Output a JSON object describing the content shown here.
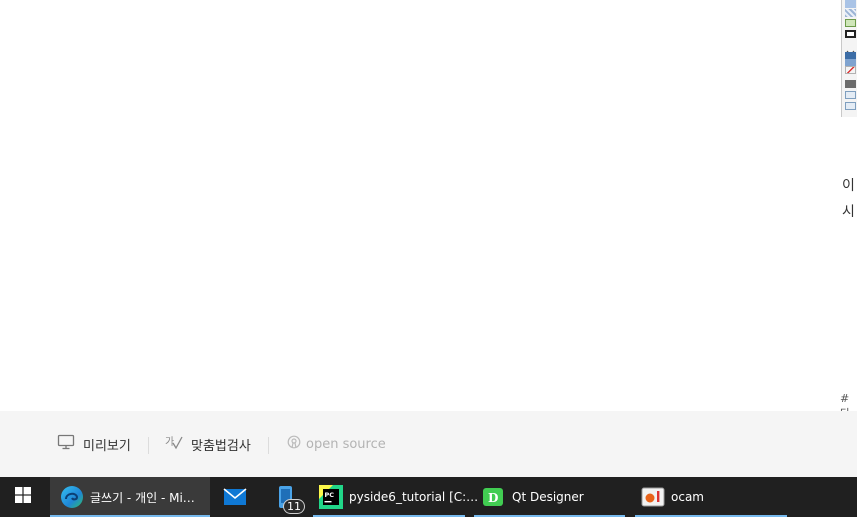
{
  "right_fragments": {
    "line1": "이",
    "line2": "시",
    "hashtag": "#타"
  },
  "editor_footer": {
    "preview_label": "미리보기",
    "spellcheck_label": "맞춤법검사",
    "opensource_label": "open source"
  },
  "taskbar": {
    "items": [
      {
        "label": "글쓰기 - 개인 - Mi…",
        "icon": "edge-icon",
        "active": true
      },
      {
        "label": "",
        "icon": "mail-icon",
        "active": false
      },
      {
        "label": "",
        "icon": "phone-link-icon",
        "badge": "11",
        "active": false
      },
      {
        "label": "pyside6_tutorial [C:…",
        "icon": "pycharm-icon",
        "active": false
      },
      {
        "label": "Qt Designer",
        "icon": "qt-designer-icon",
        "active": false
      },
      {
        "label": "ocam",
        "icon": "ocam-icon",
        "active": false
      }
    ]
  },
  "colors": {
    "taskbar_bg": "#202020",
    "active_indicator": "#76b9ed",
    "footer_bg": "#f5f5f5"
  }
}
